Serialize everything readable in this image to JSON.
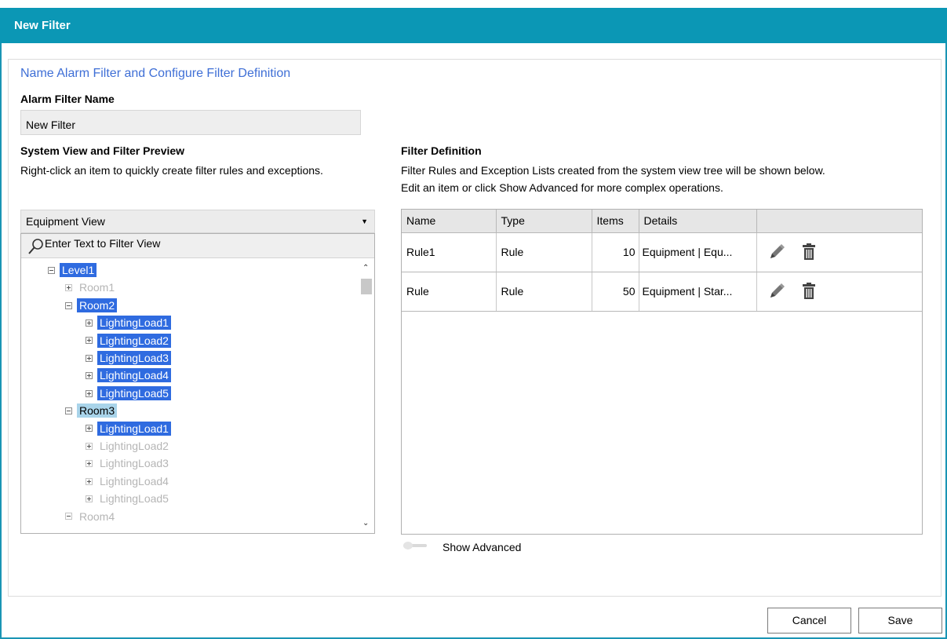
{
  "window": {
    "title": "New Filter"
  },
  "main": {
    "heading": "Name Alarm Filter and Configure Filter Definition",
    "name_label": "Alarm Filter Name",
    "name_value": "New Filter"
  },
  "left": {
    "title": "System View and Filter Preview",
    "hint": "Right-click an item to quickly create filter rules and exceptions.",
    "view_select": "Equipment View",
    "search_placeholder": "Enter Text to Filter View",
    "tree": [
      {
        "label": "Level1",
        "expander": "minus",
        "state": "selected"
      },
      {
        "label": "Room1",
        "expander": "plus",
        "state": "dim"
      },
      {
        "label": "Room2",
        "expander": "minus",
        "state": "selected"
      },
      {
        "label": "LightingLoad1",
        "expander": "plus",
        "state": "selected"
      },
      {
        "label": "LightingLoad2",
        "expander": "plus",
        "state": "selected"
      },
      {
        "label": "LightingLoad3",
        "expander": "plus",
        "state": "selected"
      },
      {
        "label": "LightingLoad4",
        "expander": "plus",
        "state": "selected"
      },
      {
        "label": "LightingLoad5",
        "expander": "plus",
        "state": "selected"
      },
      {
        "label": "Room3",
        "expander": "minus",
        "state": "partial"
      },
      {
        "label": "LightingLoad1",
        "expander": "plus",
        "state": "selected"
      },
      {
        "label": "LightingLoad2",
        "expander": "plus",
        "state": "dim"
      },
      {
        "label": "LightingLoad3",
        "expander": "plus",
        "state": "dim"
      },
      {
        "label": "LightingLoad4",
        "expander": "plus",
        "state": "dim"
      },
      {
        "label": "LightingLoad5",
        "expander": "plus",
        "state": "dim"
      },
      {
        "label": "Room4",
        "expander": "minus",
        "state": "dim"
      }
    ]
  },
  "right": {
    "title": "Filter Definition",
    "hint1": "Filter Rules and Exception Lists created from the system view tree will be shown below.",
    "hint2": "Edit an item or click Show Advanced for more complex operations.",
    "columns": [
      "Name",
      "Type",
      "Items",
      "Details",
      ""
    ],
    "rows": [
      {
        "name": "Rule1",
        "type": "Rule",
        "items": "10",
        "details": "Equipment | Equ..."
      },
      {
        "name": "Rule",
        "type": "Rule",
        "items": "50",
        "details": "Equipment | Star..."
      }
    ],
    "show_advanced_label": "Show Advanced",
    "show_advanced_on": false
  },
  "footer": {
    "cancel_label": "Cancel",
    "save_label": "Save"
  },
  "colors": {
    "title_bar": "#0b97b5",
    "heading": "#3f6fd6",
    "selection": "#2f6be0",
    "partial_selection": "#a9d4ea"
  },
  "icons": {
    "edit": "pencil-icon",
    "delete": "trash-icon",
    "search": "magnifier-icon"
  }
}
